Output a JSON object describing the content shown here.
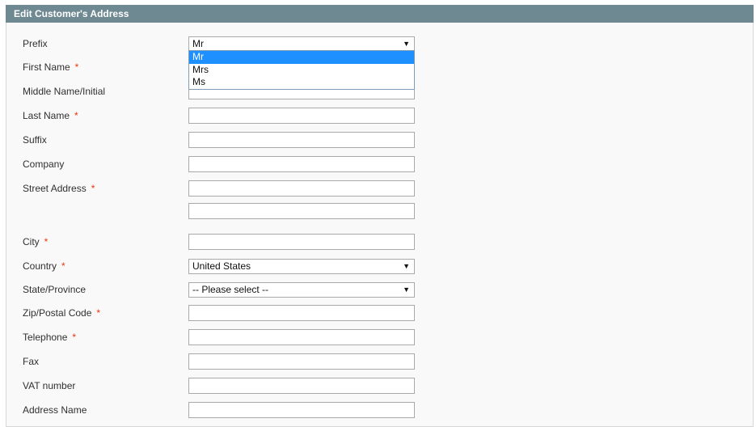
{
  "header": {
    "title": "Edit Customer's Address"
  },
  "colors": {
    "header_bg": "#6f8992",
    "required": "#eb340a",
    "selected_option": "#1e90ff"
  },
  "fields": {
    "prefix": {
      "label": "Prefix",
      "value": "Mr",
      "options": [
        "Mr",
        "Mrs",
        "Ms"
      ],
      "highlighted": "Mr"
    },
    "first_name": {
      "label": "First Name",
      "required": "*",
      "value": ""
    },
    "middle_name": {
      "label": "Middle Name/Initial",
      "value": ""
    },
    "last_name": {
      "label": "Last Name",
      "required": "*",
      "value": ""
    },
    "suffix": {
      "label": "Suffix",
      "value": ""
    },
    "company": {
      "label": "Company",
      "value": ""
    },
    "street": {
      "label": "Street Address",
      "required": "*",
      "line1": "",
      "line2": ""
    },
    "city": {
      "label": "City",
      "required": "*",
      "value": ""
    },
    "country": {
      "label": "Country",
      "required": "*",
      "value": "United States"
    },
    "state": {
      "label": "State/Province",
      "value": "-- Please select --"
    },
    "zip": {
      "label": "Zip/Postal Code",
      "required": "*",
      "value": ""
    },
    "telephone": {
      "label": "Telephone",
      "required": "*",
      "value": ""
    },
    "fax": {
      "label": "Fax",
      "value": ""
    },
    "vat": {
      "label": "VAT number",
      "value": ""
    },
    "address_name": {
      "label": "Address Name",
      "value": ""
    }
  },
  "icons": {
    "dropdown_arrow": "▼"
  }
}
